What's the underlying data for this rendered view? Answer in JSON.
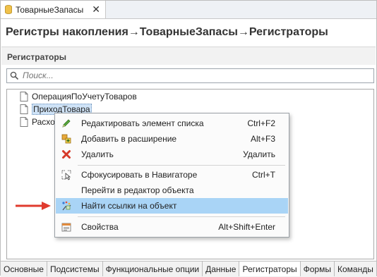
{
  "tab": {
    "title": "ТоварныеЗапасы",
    "close": "✕"
  },
  "breadcrumb": "Регистры накопления→ТоварныеЗапасы→Регистраторы",
  "panel": {
    "title": "Регистраторы"
  },
  "search": {
    "placeholder": "Поиск..."
  },
  "tree": {
    "items": [
      {
        "label": "ОперацияПоУчетуТоваров"
      },
      {
        "label": "ПриходТовара",
        "selected": true
      },
      {
        "label": "Расхо"
      }
    ]
  },
  "context_menu": {
    "items": [
      {
        "label": "Редактировать элемент списка",
        "shortcut": "Ctrl+F2",
        "icon": "pencil-icon"
      },
      {
        "label": "Добавить в расширение",
        "shortcut": "Alt+F3",
        "icon": "add-extension-icon"
      },
      {
        "label": "Удалить",
        "shortcut": "Удалить",
        "icon": "delete-x-icon"
      },
      {
        "label": "Сфокусировать в Навигаторе",
        "shortcut": "Ctrl+T",
        "icon": "navigator-focus-icon"
      },
      {
        "label": "Перейти в редактор объекта",
        "shortcut": "",
        "icon": ""
      },
      {
        "label": "Найти ссылки на объект",
        "shortcut": "",
        "icon": "find-references-icon",
        "highlighted": true
      },
      {
        "label": "Свойства",
        "shortcut": "Alt+Shift+Enter",
        "icon": "properties-icon"
      }
    ]
  },
  "bottom_tabs": [
    {
      "label": "Основные"
    },
    {
      "label": "Подсистемы"
    },
    {
      "label": "Функциональные опции"
    },
    {
      "label": "Данные"
    },
    {
      "label": "Регистраторы",
      "active": true
    },
    {
      "label": "Формы"
    },
    {
      "label": "Команды"
    }
  ],
  "colors": {
    "menu_highlight": "#a9d4f6",
    "selection": "#cfe3f7",
    "arrow": "#e03b2e"
  }
}
